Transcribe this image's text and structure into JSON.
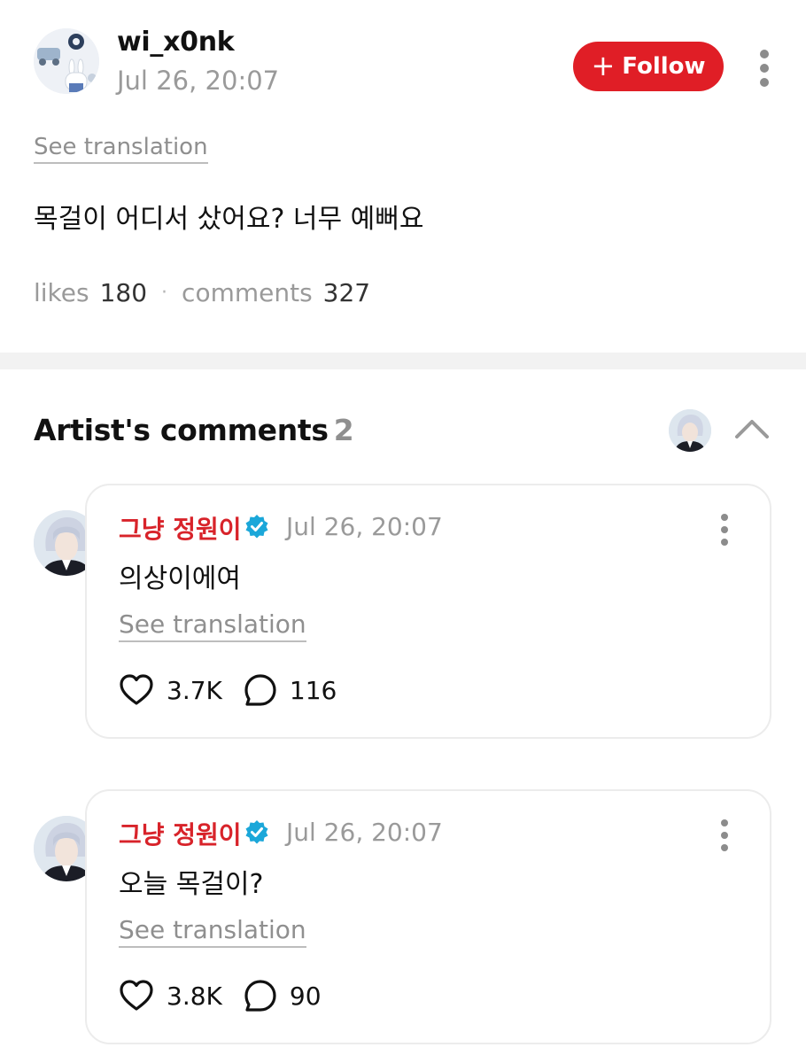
{
  "post": {
    "username": "wi_x0nk",
    "timestamp": "Jul 26, 20:07",
    "follow_label": "Follow",
    "see_translation": "See translation",
    "body": "목걸이 어디서 샀어요? 너무 예뻐요",
    "likes_label": "likes",
    "likes_count": "180",
    "comments_label": "comments",
    "comments_count": "327"
  },
  "artist_comments": {
    "title": "Artist's comments",
    "count": "2",
    "items": [
      {
        "name": "그냥 정원이",
        "timestamp": "Jul 26, 20:07",
        "text": "의상이에여",
        "see_translation": "See translation",
        "likes": "3.7K",
        "replies": "116"
      },
      {
        "name": "그냥 정원이",
        "timestamp": "Jul 26, 20:07",
        "text": "오늘 목걸이?",
        "see_translation": "See translation",
        "likes": "3.8K",
        "replies": "90"
      }
    ]
  },
  "colors": {
    "follow_button": "#e01e26",
    "artist_name": "#d8232a",
    "verified_badge": "#1ba7d9"
  },
  "icons": [
    "more-vertical-icon",
    "plus-icon",
    "chevron-up-icon",
    "verified-badge-icon",
    "heart-icon",
    "comment-bubble-icon"
  ]
}
